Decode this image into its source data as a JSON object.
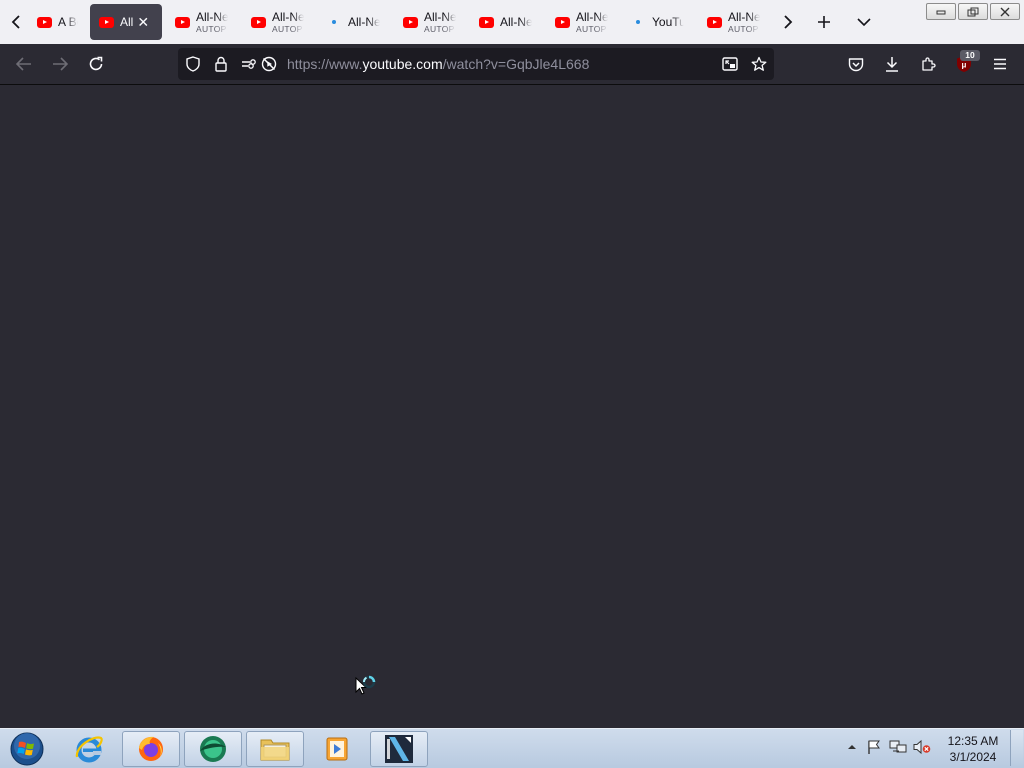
{
  "browser": {
    "tabs": [
      {
        "title": "A Bea",
        "subtitle": "",
        "favicon": "youtube-icon",
        "active": false
      },
      {
        "title": "All",
        "subtitle": "",
        "favicon": "youtube-icon",
        "active": true
      },
      {
        "title": "All-Ne",
        "subtitle": "AUTOP",
        "favicon": "youtube-icon",
        "active": false
      },
      {
        "title": "All-Ne",
        "subtitle": "AUTOP",
        "favicon": "youtube-icon",
        "active": false
      },
      {
        "title": "All-Ne",
        "subtitle": "",
        "favicon": "dot-icon",
        "active": false
      },
      {
        "title": "All-Ne",
        "subtitle": "AUTOP",
        "favicon": "youtube-icon",
        "active": false
      },
      {
        "title": "All-Ne",
        "subtitle": "",
        "favicon": "youtube-icon",
        "active": false
      },
      {
        "title": "All-Ne",
        "subtitle": "AUTOP",
        "favicon": "youtube-icon",
        "active": false
      },
      {
        "title": "YouTu",
        "subtitle": "",
        "favicon": "dot-icon",
        "active": false
      },
      {
        "title": "All-Ne",
        "subtitle": "AUTOP",
        "favicon": "youtube-icon",
        "active": false
      }
    ],
    "url": {
      "prefix": "https://www.",
      "host": "youtube.com",
      "path": "/watch?v=GqbJle4L668"
    },
    "extension_badge": "10"
  },
  "taskbar": {
    "apps": [
      "start-orb",
      "internet-explorer",
      "firefox",
      "media-app",
      "file-explorer",
      "media-player",
      "video-editor"
    ],
    "clock": {
      "time": "12:35 AM",
      "date": "3/1/2024"
    }
  },
  "colors": {
    "toolbar_bg": "#2b2a33",
    "tabstrip_bg": "#f0f0f4",
    "active_tab": "#42414d",
    "youtube_red": "#ff0000",
    "taskbar": "#c4d3e6"
  }
}
